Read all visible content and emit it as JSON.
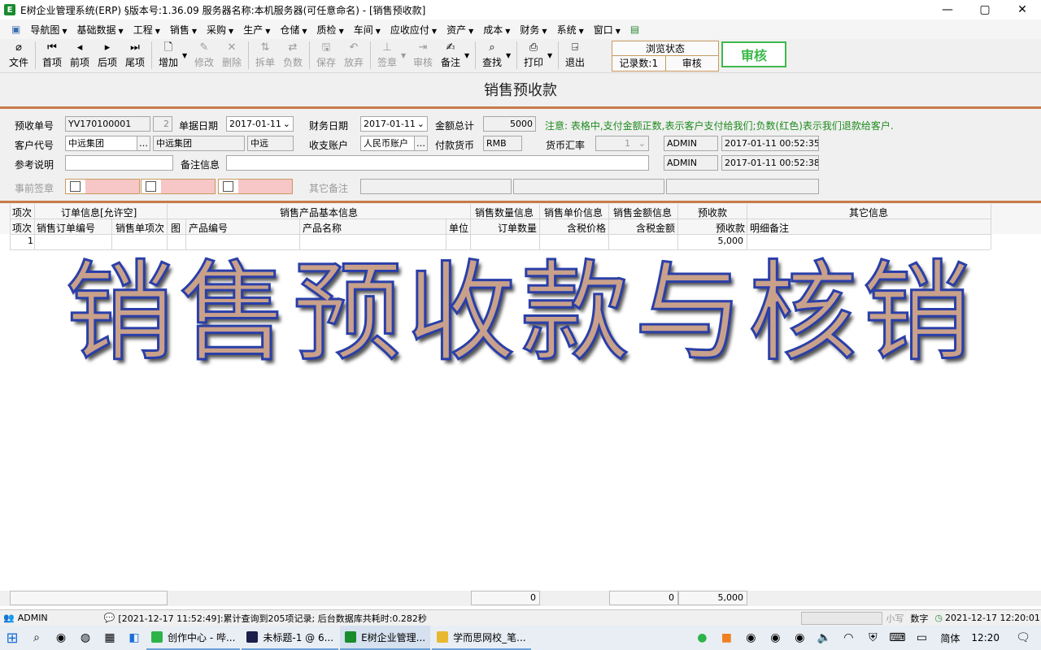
{
  "window": {
    "title": "E树企业管理系统(ERP) §版本号:1.36.09  服务器名称:本机服务器(可任意命名) - [销售预收款]",
    "min": "—",
    "max": "▢",
    "close": "✕"
  },
  "menu": [
    "导航图",
    "基础数据",
    "工程",
    "销售",
    "采购",
    "生产",
    "仓储",
    "质检",
    "车间",
    "应收应付",
    "资产",
    "成本",
    "财务",
    "系统",
    "窗口"
  ],
  "toolbar": {
    "file": "文件",
    "first": "首项",
    "prev": "前项",
    "next": "后项",
    "last": "尾项",
    "add": "增加",
    "edit": "修改",
    "delete": "删除",
    "split": "拆单",
    "negative": "负数",
    "save": "保存",
    "discard": "放弃",
    "sign": "签章",
    "review": "审核",
    "remark": "备注",
    "find": "查找",
    "print": "打印",
    "exit": "退出"
  },
  "status_box": {
    "header": "浏览状态",
    "records": "记录数:1",
    "state": "审核"
  },
  "audit_button": "审核",
  "page_title": "销售预收款",
  "form": {
    "receipt_no_label": "预收单号",
    "receipt_no": "YV170100001",
    "receipt_seq": "2",
    "doc_date_label": "单据日期",
    "doc_date": "2017-01-11",
    "fin_date_label": "财务日期",
    "fin_date": "2017-01-11",
    "total_label": "金额总计",
    "total": "5000",
    "note": "注意: 表格中,支付金额正数,表示客户支付给我们;负数(红色)表示我们退款给客户.",
    "customer_label": "客户代号",
    "customer_code": "中远集团",
    "customer_name": "中远集团",
    "customer_short": "中远",
    "account_label": "收支账户",
    "account": "人民币账户",
    "currency_label": "付款货币",
    "currency": "RMB",
    "rate_label": "货币汇率",
    "rate": "1",
    "creator": "ADMIN",
    "created_time": "2017-01-11 00:52:35",
    "ref_label": "参考说明",
    "ref": "",
    "remark_label": "备注信息",
    "remark": "",
    "modifier": "ADMIN",
    "modified_time": "2017-01-11 00:52:38",
    "presign_label": "事前签章",
    "other_remark_label": "其它备注"
  },
  "grid": {
    "group_headers": {
      "item": "项次",
      "order": "订单信息[允许空]",
      "product": "销售产品基本信息",
      "qty": "销售数量信息",
      "price": "销售单价信息",
      "amount": "销售金额信息",
      "prepay": "预收款",
      "other": "其它信息"
    },
    "columns": {
      "item": "项次",
      "order_no": "销售订单编号",
      "order_item": "销售单项次",
      "img": "图",
      "product_no": "产品编号",
      "product_name": "产品名称",
      "unit": "单位",
      "order_qty": "订单数量",
      "tax_price": "含税价格",
      "tax_amount": "含税金额",
      "prepay": "预收款",
      "detail_remark": "明细备注"
    },
    "rows": [
      {
        "item": "1",
        "prepay": "5,000"
      }
    ],
    "totals": {
      "qty": "0",
      "amount": "0",
      "prepay": "5,000"
    }
  },
  "watermark": "销售预收款与核销",
  "statusbar": {
    "user": "ADMIN",
    "message": "[2021-12-17 11:52:49]:累计查询到205项记录; 后台数据库共耗时:0.282秒",
    "small": "小写",
    "digit": "数字",
    "clock": "2021-12-17 12:20:01"
  },
  "taskbar": {
    "apps": [
      "创作中心 - 哔...",
      "未标题-1 @ 6...",
      "E树企业管理...",
      "学而思网校_笔..."
    ],
    "ime": "简体",
    "time": "12:20"
  },
  "colors": {
    "accent_green": "#3cb94a",
    "separator": "#c87a4a",
    "note_green": "#1f8a1f",
    "pink": "#f7c6c6"
  }
}
